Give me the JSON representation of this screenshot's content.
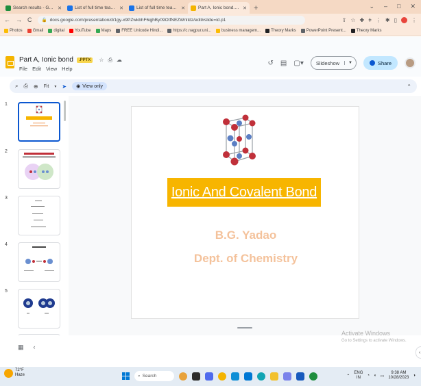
{
  "browser": {
    "tabs": [
      {
        "title": "Search results - Google Drive",
        "color": "#1e8e3e",
        "active": false
      },
      {
        "title": "List of full time teachers google",
        "color": "#1a73e8",
        "active": false
      },
      {
        "title": "List of full time teachers (CT22",
        "color": "#1a73e8",
        "active": false
      },
      {
        "title": "Part A, Ionic bond.pptx - Google",
        "color": "#f4b400",
        "active": true
      }
    ],
    "new_tab": "+",
    "window_controls": [
      "⌄",
      "–",
      "□",
      "✕"
    ],
    "url": "docs.google.com/presentation/d/1gy-x9PZwkbhF6qjhBy09OtfNEZWnltdz/edit#slide=id.p1",
    "bookmarks": [
      {
        "label": "Photos",
        "color": "#fbbc04"
      },
      {
        "label": "Gmail",
        "color": "#ea4335"
      },
      {
        "label": "digital",
        "color": "#34a853"
      },
      {
        "label": "YouTube",
        "color": "#ff0000"
      },
      {
        "label": "Maps",
        "color": "#34a853"
      },
      {
        "label": "FREE Unicode Hindi...",
        "color": "#5f6368"
      },
      {
        "label": "https://c.nagpur.uni...",
        "color": "#5f6368"
      },
      {
        "label": "business managem...",
        "color": "#fbbc04"
      },
      {
        "label": "Theory Marks",
        "color": "#202124"
      },
      {
        "label": "PowerPoint Present...",
        "color": "#5f6368"
      },
      {
        "label": "Theory Marks",
        "color": "#202124"
      }
    ]
  },
  "doc": {
    "title": "Part A, Ionic bond",
    "badge": ".PPTX",
    "menus": [
      "File",
      "Edit",
      "View",
      "Help"
    ],
    "slideshow_label": "Slideshow",
    "share_label": "Share"
  },
  "toolbar": {
    "zoom_label": "Fit",
    "view_only_label": "View only"
  },
  "filmstrip": {
    "slide_numbers": [
      "1",
      "2",
      "3",
      "4",
      "5"
    ],
    "selected": 1
  },
  "slide": {
    "title": "Ionic And Covalent Bond",
    "author": "B.G. Yadao",
    "department": "Dept. of Chemistry",
    "title_bg": "#f7b500",
    "text_color": "#f4c29b"
  },
  "watermark": {
    "line1": "Activate Windows",
    "line2": "Go to Settings to activate Windows."
  },
  "taskbar": {
    "temperature": "72°F",
    "weather": "Haze",
    "search_placeholder": "Search",
    "lang_top": "ENG",
    "lang_bottom": "IN",
    "time": "9:38 AM",
    "date": "10/28/2023"
  }
}
